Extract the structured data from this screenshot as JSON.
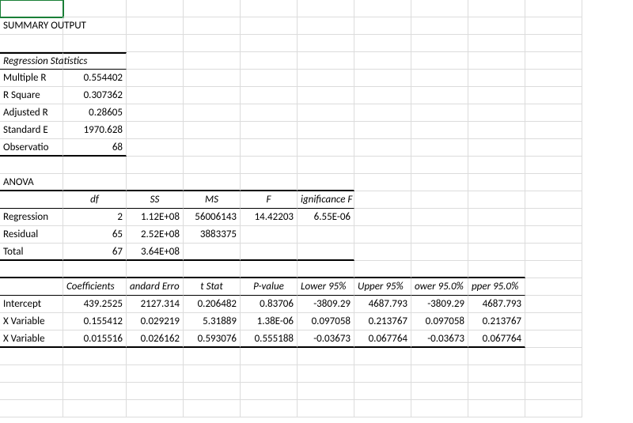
{
  "title": "SUMMARY OUTPUT",
  "regstats_header": "Regression Statistics",
  "regstats": {
    "r0": {
      "label": "Multiple R",
      "val": "0.554402"
    },
    "r1": {
      "label": "R Square",
      "val": "0.307362"
    },
    "r2": {
      "label": "Adjusted R",
      "val": "0.28605"
    },
    "r3": {
      "label": "Standard E",
      "val": "1970.628"
    },
    "r4": {
      "label": "Observatio",
      "val": "68"
    }
  },
  "anova_header": "ANOVA",
  "anova_cols": {
    "df": "df",
    "ss": "SS",
    "ms": "MS",
    "f": "F",
    "sigf": "ignificance F"
  },
  "anova": {
    "reg": {
      "label": "Regression",
      "df": "2",
      "ss": "1.12E+08",
      "ms": "56006143",
      "f": "14.42203",
      "sigf": "6.55E-06"
    },
    "res": {
      "label": "Residual",
      "df": "65",
      "ss": "2.52E+08",
      "ms": "3883375"
    },
    "tot": {
      "label": "Total",
      "df": "67",
      "ss": "3.64E+08"
    }
  },
  "coef_cols": {
    "c1": "Coefficients",
    "c2": "andard Erro",
    "c3": "t Stat",
    "c4": "P-value",
    "c5": "Lower 95%",
    "c6": "Upper 95%",
    "c7": "ower 95.0%",
    "c8": "pper 95.0%"
  },
  "coef": {
    "r0": {
      "label": "Intercept",
      "c1": "439.2525",
      "c2": "2127.314",
      "c3": "0.206482",
      "c4": "0.83706",
      "c5": "-3809.29",
      "c6": "4687.793",
      "c7": "-3809.29",
      "c8": "4687.793"
    },
    "r1": {
      "label": "X Variable",
      "c1": "0.155412",
      "c2": "0.029219",
      "c3": "5.31889",
      "c4": "1.38E-06",
      "c5": "0.097058",
      "c6": "0.213767",
      "c7": "0.097058",
      "c8": "0.213767"
    },
    "r2": {
      "label": "X Variable",
      "c1": "0.015516",
      "c2": "0.026162",
      "c3": "0.593076",
      "c4": "0.555188",
      "c5": "-0.03673",
      "c6": "0.067764",
      "c7": "-0.03673",
      "c8": "0.067764"
    }
  }
}
